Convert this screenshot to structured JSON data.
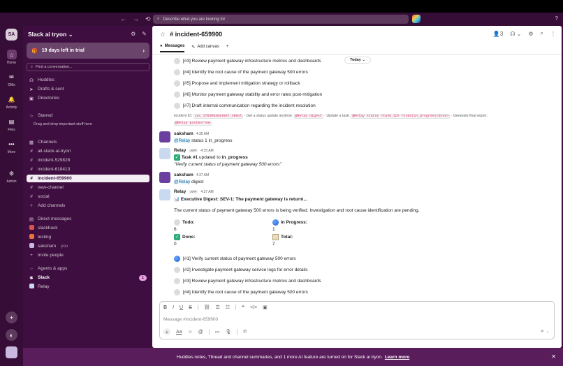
{
  "topbar": {
    "search_placeholder": "Describe what you are looking for",
    "back_icon": "←",
    "forward_icon": "→",
    "history_icon": "⟲",
    "help_icon": "?"
  },
  "rail": {
    "workspace_initials": "SA",
    "items": [
      {
        "label": "Home",
        "icon": "⌂"
      },
      {
        "label": "DMs",
        "icon": "✉"
      },
      {
        "label": "Activity",
        "icon": "🔔"
      },
      {
        "label": "Files",
        "icon": "▤"
      },
      {
        "label": "More",
        "icon": "•••"
      },
      {
        "label": "Admin",
        "icon": "⚙"
      }
    ],
    "add_icon": "+",
    "theme_icon": "◐"
  },
  "sidebar": {
    "workspace_name": "Slack ai tryon",
    "workspace_chevron": "⌄",
    "trial_text": "19 days left in trial",
    "find_placeholder": "Find a conversation...",
    "nav": [
      {
        "label": "Huddles",
        "icon": "☊"
      },
      {
        "label": "Drafts & sent",
        "icon": "➤"
      },
      {
        "label": "Directories",
        "icon": "▣"
      }
    ],
    "starred_header": "Starred",
    "starred_hint": "Drag and drop important stuff here",
    "channels_header": "Channels",
    "channels": [
      {
        "name": "all-slack-ai-tryon"
      },
      {
        "name": "incident-529828"
      },
      {
        "name": "incident-618413"
      },
      {
        "name": "incident-659900"
      },
      {
        "name": "new-channel"
      },
      {
        "name": "social"
      }
    ],
    "add_channels": "Add channels",
    "dm_header": "Direct messages",
    "dms": [
      {
        "name": "slackhack",
        "color": "#d9534f"
      },
      {
        "name": "testing",
        "color": "#e8743b"
      },
      {
        "name": "saksham",
        "color": "#c9b8e0",
        "you": "you"
      }
    ],
    "invite_people": "Invite people",
    "agents_header": "Agents & apps",
    "agents": [
      {
        "name": "Slack",
        "badge": "1"
      },
      {
        "name": "Relay"
      }
    ]
  },
  "channel": {
    "title": "# incident-659900",
    "member_count": "3",
    "tabs": {
      "messages": "Messages",
      "add_canvas": "Add canvas",
      "add": "+"
    }
  },
  "messages": {
    "today": "Today",
    "early_tasks": [
      "[#3] Review payment gateway infrastructure metrics and dashboards",
      "[#4] Identify the root cause of the payment gateway 500 errors",
      "[#5] Propose and implement mitigation strategy or rollback",
      "[#6] Monitor payment gateway stability and error rates post-mitigation",
      "[#7] Draft internal communication regarding the incident resolution"
    ],
    "meta": {
      "incident_label": "Incident ID:",
      "incident_id": "inc_1783983644567_498ol",
      "status_text": "· Get a status update anytime:",
      "status_cmd": "@Relay digest",
      "update_text": "· Update a task:",
      "update_cmd": "@Relay status <task_id> <todo|in_progress|done>",
      "final_text": "· Generate final report:",
      "final_cmd": "@Relay postmortem"
    },
    "m1": {
      "name": "saksham",
      "time": "4:35 AM",
      "mention": "@Relay",
      "text": " status 1 in_progress"
    },
    "m2": {
      "name": "Relay",
      "app": "APP",
      "time": "4:35 AM",
      "line1a": "Task #1",
      "line1b": " updated to ",
      "line1c": "in_progress",
      "line2": "\"Verify current status of payment gateway 500 errors\""
    },
    "m3": {
      "name": "saksham",
      "time": "4:37 AM",
      "mention": "@Relay",
      "text": " digest"
    },
    "m4": {
      "name": "Relay",
      "app": "APP",
      "time": "4:37 AM",
      "digest_title": "Executive Digest: SEV-1: The payment gateway is returni...",
      "summary": "The current status of payment gateway 500 errors is being verified. Investigation and root cause identification are pending.",
      "todo_label": "Todo:",
      "todo_val": "6",
      "inprog_label": "In Progress:",
      "inprog_val": "1",
      "done_label": "Done:",
      "done_val": "0",
      "total_label": "Total:",
      "total_val": "7",
      "tasks": [
        "[#1] Verify current status of payment gateway 500 errors",
        "[#2] Investigate payment gateway service logs for error details",
        "[#3] Review payment gateway infrastructure metrics and dashboards",
        "[#4] Identify the root cause of the payment gateway 500 errors"
      ]
    }
  },
  "composer": {
    "placeholder": "Message #incident-659900"
  },
  "banner": {
    "text": "Huddles notes, Thread and channel summaries, and 1 more AI feature are turned on for Slack ai tryon.",
    "link": "Learn more"
  }
}
